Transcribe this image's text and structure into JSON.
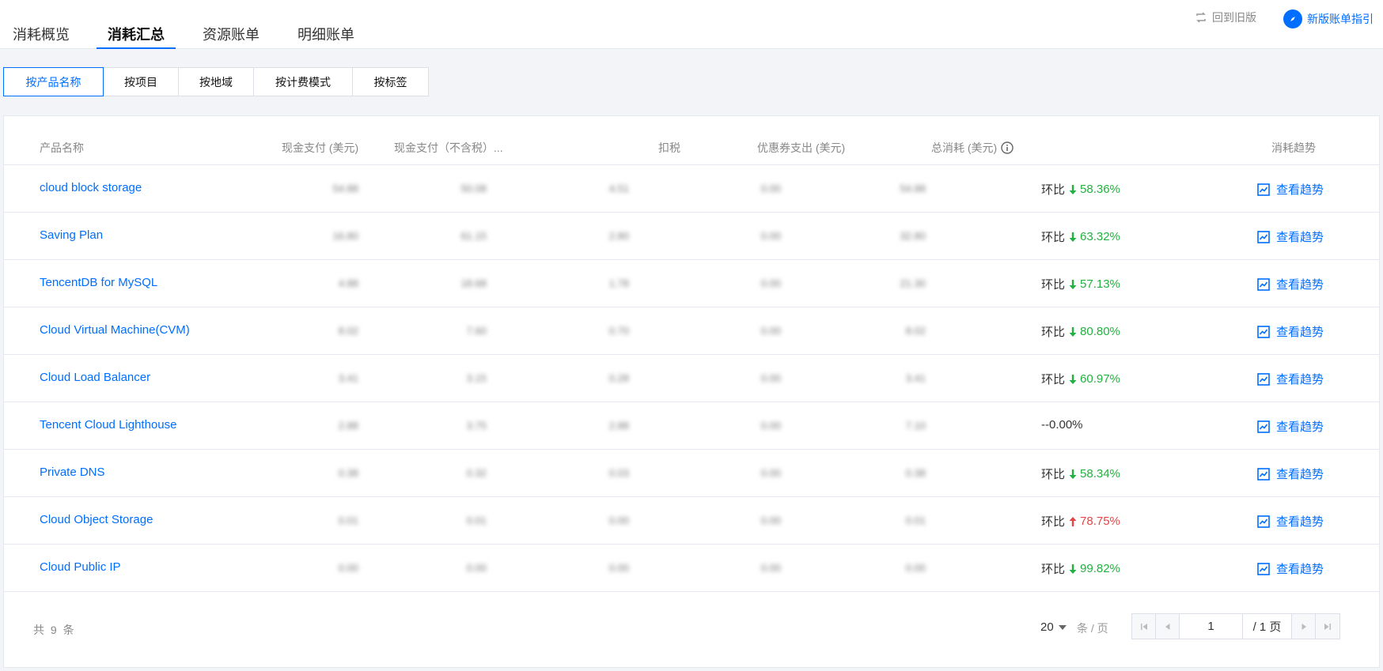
{
  "tabs": [
    {
      "label": "消耗概览",
      "active": false
    },
    {
      "label": "消耗汇总",
      "active": true
    },
    {
      "label": "资源账单",
      "active": false
    },
    {
      "label": "明细账单",
      "active": false
    }
  ],
  "header_links": {
    "back_label": "回到旧版",
    "guide_label": "新版账单指引",
    "back_icon": "refresh-icon",
    "guide_icon": "compass-icon"
  },
  "segments": [
    {
      "label": "按产品名称",
      "active": true
    },
    {
      "label": "按项目",
      "active": false
    },
    {
      "label": "按地域",
      "active": false
    },
    {
      "label": "按计费模式",
      "active": false
    },
    {
      "label": "按标签",
      "active": false
    }
  ],
  "table": {
    "headers": {
      "product": "产品名称",
      "cash": "现金支付 (美元)",
      "cash_notax": "现金支付（不含税）...",
      "tax": "扣税",
      "coupon": "优惠券支出 (美元)",
      "total": "总消耗 (美元)",
      "trend": "消耗趋势"
    },
    "rows": [
      {
        "product": "cloud block storage",
        "cash": "54.88",
        "cash_notax": "50.08",
        "tax": "4.51",
        "coupon": "0.00",
        "total": "54.88",
        "mom_label": "环比",
        "mom_dir": "down",
        "mom_pct": "58.36%",
        "trend_label": "查看趋势"
      },
      {
        "product": "Saving Plan",
        "cash": "16.80",
        "cash_notax": "61.15",
        "tax": "2.80",
        "coupon": "0.00",
        "total": "32.80",
        "mom_label": "环比",
        "mom_dir": "down",
        "mom_pct": "63.32%",
        "trend_label": "查看趋势"
      },
      {
        "product": "TencentDB for MySQL",
        "cash": "4.88",
        "cash_notax": "18.68",
        "tax": "1.78",
        "coupon": "0.00",
        "total": "21.30",
        "mom_label": "环比",
        "mom_dir": "down",
        "mom_pct": "57.13%",
        "trend_label": "查看趋势"
      },
      {
        "product": "Cloud Virtual Machine(CVM)",
        "cash": "8.02",
        "cash_notax": "7.60",
        "tax": "0.70",
        "coupon": "0.00",
        "total": "8.02",
        "mom_label": "环比",
        "mom_dir": "down",
        "mom_pct": "80.80%",
        "trend_label": "查看趋势"
      },
      {
        "product": "Cloud Load Balancer",
        "cash": "3.41",
        "cash_notax": "3.15",
        "tax": "0.28",
        "coupon": "0.00",
        "total": "3.41",
        "mom_label": "环比",
        "mom_dir": "down",
        "mom_pct": "60.97%",
        "trend_label": "查看趋势"
      },
      {
        "product": "Tencent Cloud Lighthouse",
        "cash": "2.88",
        "cash_notax": "3.75",
        "tax": "2.88",
        "coupon": "0.00",
        "total": "7.10",
        "mom_label": "",
        "mom_dir": "none",
        "mom_pct": "--0.00%",
        "trend_label": "查看趋势"
      },
      {
        "product": "Private DNS",
        "cash": "0.38",
        "cash_notax": "0.32",
        "tax": "0.03",
        "coupon": "0.00",
        "total": "0.38",
        "mom_label": "环比",
        "mom_dir": "down",
        "mom_pct": "58.34%",
        "trend_label": "查看趋势"
      },
      {
        "product": "Cloud Object Storage",
        "cash": "0.01",
        "cash_notax": "0.01",
        "tax": "0.00",
        "coupon": "0.00",
        "total": "0.01",
        "mom_label": "环比",
        "mom_dir": "up",
        "mom_pct": "78.75%",
        "trend_label": "查看趋势"
      },
      {
        "product": "Cloud Public IP",
        "cash": "0.00",
        "cash_notax": "0.00",
        "tax": "0.00",
        "coupon": "0.00",
        "total": "0.00",
        "mom_label": "环比",
        "mom_dir": "down",
        "mom_pct": "99.82%",
        "trend_label": "查看趋势"
      }
    ]
  },
  "footer": {
    "total_label": "共 9 条",
    "page_size": "20",
    "per_page_label": "条 / 页",
    "current_page": "1",
    "total_pages_label": "/ 1 页"
  },
  "colors": {
    "accent": "#006eff",
    "down": "#21b13f",
    "up": "#e54545"
  }
}
